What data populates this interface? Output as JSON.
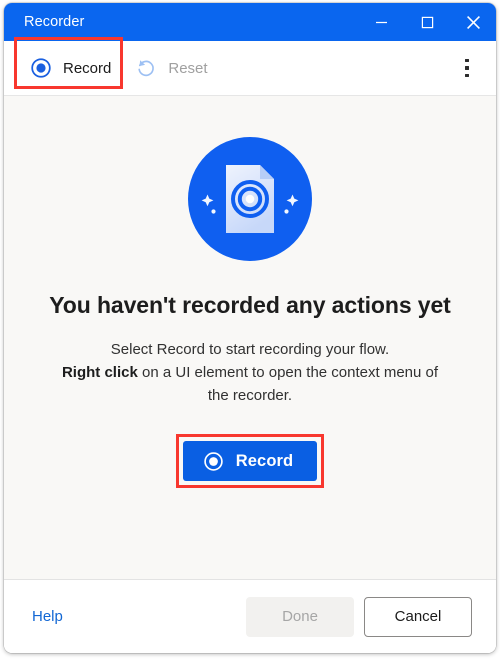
{
  "window": {
    "title": "Recorder",
    "controls": [
      {
        "name": "minimize",
        "glyph": "minimize-icon"
      },
      {
        "name": "maximize",
        "glyph": "maximize-icon"
      },
      {
        "name": "close",
        "glyph": "close-icon"
      }
    ]
  },
  "toolbar": {
    "record_label": "Record",
    "reset_label": "Reset",
    "record_icon": "record-circle-icon",
    "reset_icon": "reset-arrow-icon",
    "overflow_icon": "more-vertical-icon",
    "reset_disabled": true
  },
  "main": {
    "hero_icon": "document-record-icon",
    "headline": "You haven't recorded any actions yet",
    "description_line1": "Select Record to start recording your flow.",
    "description_bold": "Right click",
    "description_rest": " on a UI element to open the context menu of the recorder.",
    "record_button_label": "Record",
    "record_button_icon": "record-circle-icon"
  },
  "footer": {
    "help_label": "Help",
    "done_label": "Done",
    "cancel_label": "Cancel",
    "done_disabled": true
  },
  "colors": {
    "titlebar_blue": "#0a66ef",
    "accent_blue": "#0a5fe3",
    "link_blue": "#1267d4",
    "highlight_red": "#f8372e",
    "content_bg": "#f9f8f6"
  }
}
